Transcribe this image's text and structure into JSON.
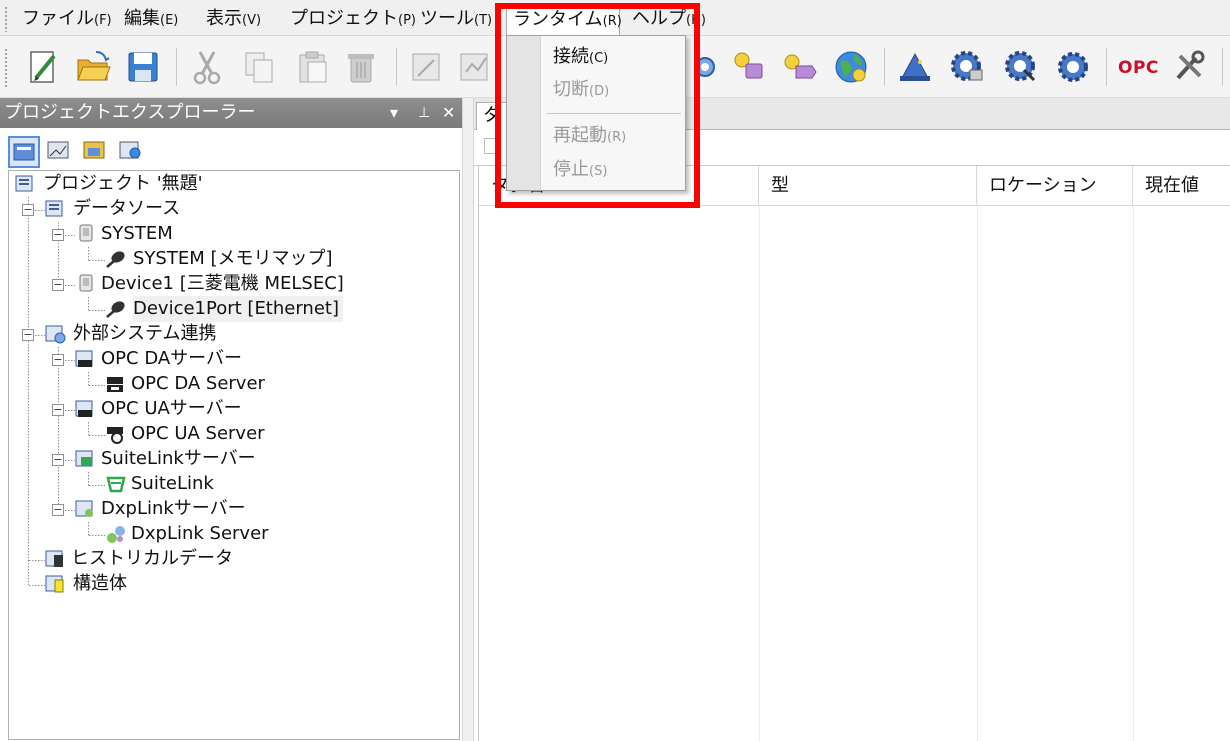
{
  "menubar": {
    "items": [
      {
        "label": "ファイル",
        "acc": "(F)"
      },
      {
        "label": "編集",
        "acc": "(E)"
      },
      {
        "label": "表示",
        "acc": "(V)"
      },
      {
        "label": "プロジェクト",
        "acc": "(P)"
      },
      {
        "label": "ツール",
        "acc": "(T)"
      },
      {
        "label": "ランタイム",
        "acc": "(R)"
      },
      {
        "label": "ヘルプ",
        "acc": "(H)"
      }
    ]
  },
  "runtime_menu": {
    "items": [
      {
        "label": "接続",
        "acc": "(C)",
        "enabled": true
      },
      {
        "label": "切断",
        "acc": "(D)",
        "enabled": false
      },
      {
        "label": "再起動",
        "acc": "(R)",
        "enabled": false
      },
      {
        "label": "停止",
        "acc": "(S)",
        "enabled": false
      }
    ]
  },
  "toolbar": {
    "icons": [
      "new-icon",
      "open-folder-icon",
      "save-icon",
      "cut-icon",
      "copy-icon",
      "paste-icon",
      "delete-icon",
      "import-icon",
      "export-icon",
      "connect-icon",
      "device-key-icon",
      "tag-key-icon",
      "globe-icon",
      "wizard-icon",
      "gear-monitor-icon",
      "gear-search-icon",
      "gear-icon",
      "settings-tools-icon"
    ],
    "opc_label": "OPC"
  },
  "explorer": {
    "title": "プロジェクトエクスプローラー",
    "pin_symbol": "▾",
    "dock_symbol": "ᵖ",
    "close_symbol": "✕",
    "tree": {
      "root": "プロジェクト '無題'",
      "datasource": "データソース",
      "system": "SYSTEM",
      "system_port": "SYSTEM [メモリマップ]",
      "device1": "Device1 [三菱電機 MELSEC]",
      "device1_port": "Device1Port [Ethernet]",
      "external": "外部システム連携",
      "opcda_group": "OPC DAサーバー",
      "opcda_server": "OPC DA Server",
      "opcua_group": "OPC UAサーバー",
      "opcua_server": "OPC UA Server",
      "suitelink_group": "SuiteLinkサーバー",
      "suitelink": "SuiteLink",
      "dxplink_group": "DxpLinkサーバー",
      "dxplink_server": "DxpLink Server",
      "historical": "ヒストリカルデータ",
      "structure": "構造体"
    }
  },
  "document": {
    "tab_label": "タ",
    "columns": [
      "タグ名",
      "型",
      "ロケーション",
      "現在値"
    ]
  },
  "colors": {
    "highlight": "#ff0000",
    "header_gray": "#808080",
    "opc_red": "#c8102e"
  }
}
